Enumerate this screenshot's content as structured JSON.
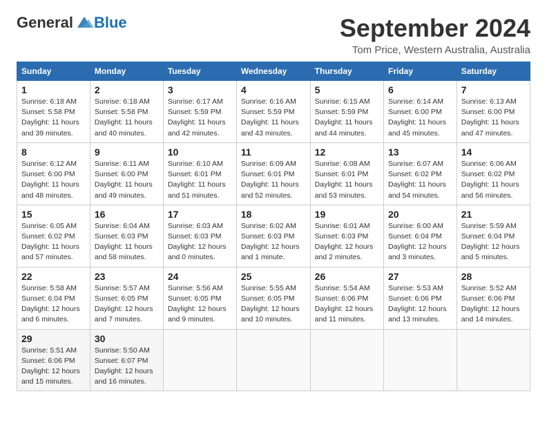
{
  "header": {
    "logo_general": "General",
    "logo_blue": "Blue",
    "month_title": "September 2024",
    "location": "Tom Price, Western Australia, Australia"
  },
  "weekdays": [
    "Sunday",
    "Monday",
    "Tuesday",
    "Wednesday",
    "Thursday",
    "Friday",
    "Saturday"
  ],
  "weeks": [
    [
      {
        "day": "1",
        "sunrise": "Sunrise: 6:18 AM",
        "sunset": "Sunset: 5:58 PM",
        "daylight": "Daylight: 11 hours and 39 minutes."
      },
      {
        "day": "2",
        "sunrise": "Sunrise: 6:18 AM",
        "sunset": "Sunset: 5:58 PM",
        "daylight": "Daylight: 11 hours and 40 minutes."
      },
      {
        "day": "3",
        "sunrise": "Sunrise: 6:17 AM",
        "sunset": "Sunset: 5:59 PM",
        "daylight": "Daylight: 11 hours and 42 minutes."
      },
      {
        "day": "4",
        "sunrise": "Sunrise: 6:16 AM",
        "sunset": "Sunset: 5:59 PM",
        "daylight": "Daylight: 11 hours and 43 minutes."
      },
      {
        "day": "5",
        "sunrise": "Sunrise: 6:15 AM",
        "sunset": "Sunset: 5:59 PM",
        "daylight": "Daylight: 11 hours and 44 minutes."
      },
      {
        "day": "6",
        "sunrise": "Sunrise: 6:14 AM",
        "sunset": "Sunset: 6:00 PM",
        "daylight": "Daylight: 11 hours and 45 minutes."
      },
      {
        "day": "7",
        "sunrise": "Sunrise: 6:13 AM",
        "sunset": "Sunset: 6:00 PM",
        "daylight": "Daylight: 11 hours and 47 minutes."
      }
    ],
    [
      {
        "day": "8",
        "sunrise": "Sunrise: 6:12 AM",
        "sunset": "Sunset: 6:00 PM",
        "daylight": "Daylight: 11 hours and 48 minutes."
      },
      {
        "day": "9",
        "sunrise": "Sunrise: 6:11 AM",
        "sunset": "Sunset: 6:00 PM",
        "daylight": "Daylight: 11 hours and 49 minutes."
      },
      {
        "day": "10",
        "sunrise": "Sunrise: 6:10 AM",
        "sunset": "Sunset: 6:01 PM",
        "daylight": "Daylight: 11 hours and 51 minutes."
      },
      {
        "day": "11",
        "sunrise": "Sunrise: 6:09 AM",
        "sunset": "Sunset: 6:01 PM",
        "daylight": "Daylight: 11 hours and 52 minutes."
      },
      {
        "day": "12",
        "sunrise": "Sunrise: 6:08 AM",
        "sunset": "Sunset: 6:01 PM",
        "daylight": "Daylight: 11 hours and 53 minutes."
      },
      {
        "day": "13",
        "sunrise": "Sunrise: 6:07 AM",
        "sunset": "Sunset: 6:02 PM",
        "daylight": "Daylight: 11 hours and 54 minutes."
      },
      {
        "day": "14",
        "sunrise": "Sunrise: 6:06 AM",
        "sunset": "Sunset: 6:02 PM",
        "daylight": "Daylight: 11 hours and 56 minutes."
      }
    ],
    [
      {
        "day": "15",
        "sunrise": "Sunrise: 6:05 AM",
        "sunset": "Sunset: 6:02 PM",
        "daylight": "Daylight: 11 hours and 57 minutes."
      },
      {
        "day": "16",
        "sunrise": "Sunrise: 6:04 AM",
        "sunset": "Sunset: 6:03 PM",
        "daylight": "Daylight: 11 hours and 58 minutes."
      },
      {
        "day": "17",
        "sunrise": "Sunrise: 6:03 AM",
        "sunset": "Sunset: 6:03 PM",
        "daylight": "Daylight: 12 hours and 0 minutes."
      },
      {
        "day": "18",
        "sunrise": "Sunrise: 6:02 AM",
        "sunset": "Sunset: 6:03 PM",
        "daylight": "Daylight: 12 hours and 1 minute."
      },
      {
        "day": "19",
        "sunrise": "Sunrise: 6:01 AM",
        "sunset": "Sunset: 6:03 PM",
        "daylight": "Daylight: 12 hours and 2 minutes."
      },
      {
        "day": "20",
        "sunrise": "Sunrise: 6:00 AM",
        "sunset": "Sunset: 6:04 PM",
        "daylight": "Daylight: 12 hours and 3 minutes."
      },
      {
        "day": "21",
        "sunrise": "Sunrise: 5:59 AM",
        "sunset": "Sunset: 6:04 PM",
        "daylight": "Daylight: 12 hours and 5 minutes."
      }
    ],
    [
      {
        "day": "22",
        "sunrise": "Sunrise: 5:58 AM",
        "sunset": "Sunset: 6:04 PM",
        "daylight": "Daylight: 12 hours and 6 minutes."
      },
      {
        "day": "23",
        "sunrise": "Sunrise: 5:57 AM",
        "sunset": "Sunset: 6:05 PM",
        "daylight": "Daylight: 12 hours and 7 minutes."
      },
      {
        "day": "24",
        "sunrise": "Sunrise: 5:56 AM",
        "sunset": "Sunset: 6:05 PM",
        "daylight": "Daylight: 12 hours and 9 minutes."
      },
      {
        "day": "25",
        "sunrise": "Sunrise: 5:55 AM",
        "sunset": "Sunset: 6:05 PM",
        "daylight": "Daylight: 12 hours and 10 minutes."
      },
      {
        "day": "26",
        "sunrise": "Sunrise: 5:54 AM",
        "sunset": "Sunset: 6:06 PM",
        "daylight": "Daylight: 12 hours and 11 minutes."
      },
      {
        "day": "27",
        "sunrise": "Sunrise: 5:53 AM",
        "sunset": "Sunset: 6:06 PM",
        "daylight": "Daylight: 12 hours and 13 minutes."
      },
      {
        "day": "28",
        "sunrise": "Sunrise: 5:52 AM",
        "sunset": "Sunset: 6:06 PM",
        "daylight": "Daylight: 12 hours and 14 minutes."
      }
    ],
    [
      {
        "day": "29",
        "sunrise": "Sunrise: 5:51 AM",
        "sunset": "Sunset: 6:06 PM",
        "daylight": "Daylight: 12 hours and 15 minutes."
      },
      {
        "day": "30",
        "sunrise": "Sunrise: 5:50 AM",
        "sunset": "Sunset: 6:07 PM",
        "daylight": "Daylight: 12 hours and 16 minutes."
      },
      null,
      null,
      null,
      null,
      null
    ]
  ]
}
